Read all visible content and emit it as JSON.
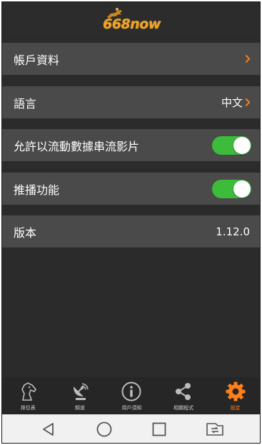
{
  "header": {
    "logo_text": "668now"
  },
  "settings": [
    {
      "label": "帳戶資料",
      "value": "",
      "control": "chevron"
    },
    {
      "label": "語言",
      "value": "中文",
      "control": "chevron"
    },
    {
      "label": "允許以流動數據串流影片",
      "value": "",
      "control": "toggle",
      "on": true
    },
    {
      "label": "推播功能",
      "value": "",
      "control": "toggle",
      "on": true
    },
    {
      "label": "版本",
      "value": "1.12.0",
      "control": "none"
    }
  ],
  "tabs": [
    {
      "label": "排位表",
      "icon": "horse-head-icon",
      "active": false
    },
    {
      "label": "頻道",
      "icon": "satellite-dish-icon",
      "active": false
    },
    {
      "label": "用戶須知",
      "icon": "info-icon",
      "active": false
    },
    {
      "label": "相關程式",
      "icon": "share-icon",
      "active": false
    },
    {
      "label": "設定",
      "icon": "gear-icon",
      "active": true
    }
  ],
  "colors": {
    "background": "#2b2b2b",
    "row": "#4a4a4a",
    "accent": "#ff7f1a",
    "toggle_on": "#3dbb3b",
    "logo": "#f3a21d"
  },
  "system_nav": [
    "back-icon",
    "home-icon",
    "recents-icon",
    "switch-sim-icon"
  ]
}
